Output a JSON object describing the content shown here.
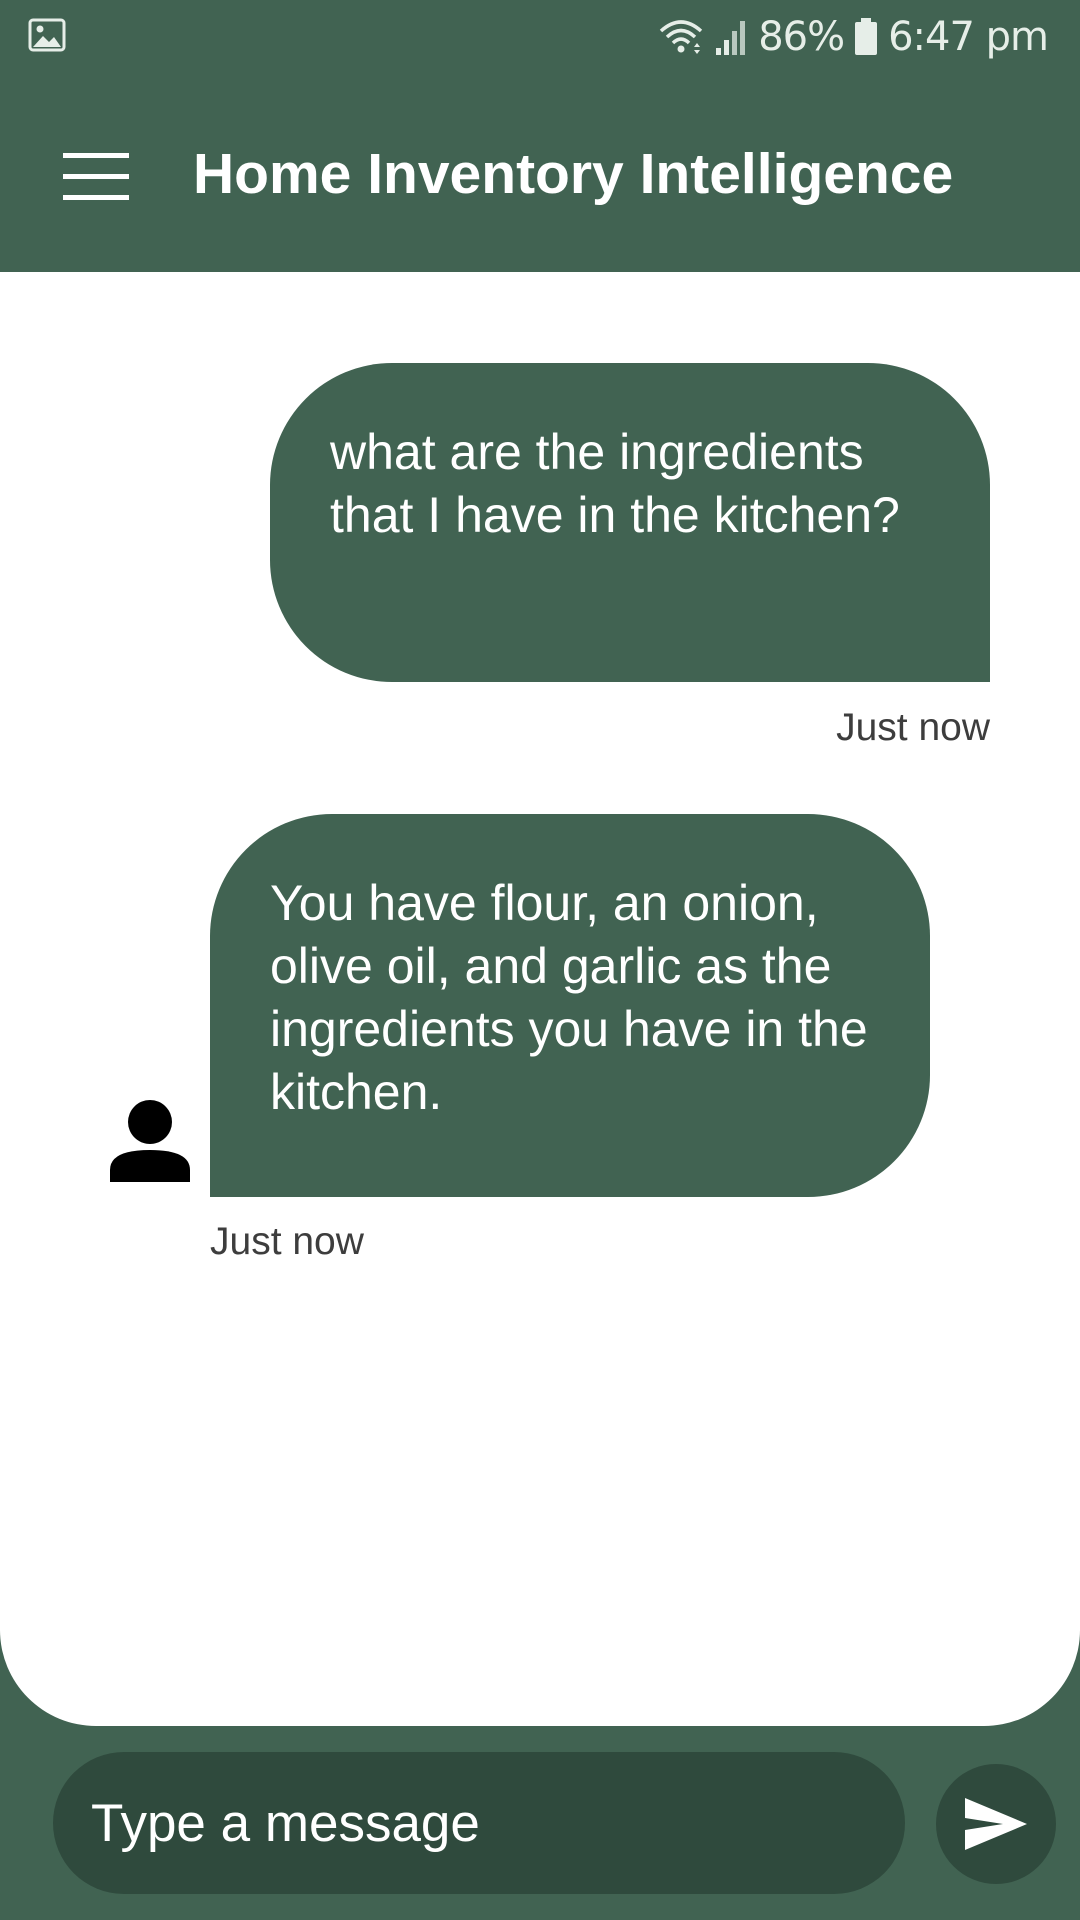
{
  "status_bar": {
    "battery": "86%",
    "time": "6:47 pm",
    "icons": [
      "gallery-icon",
      "wifi-icon",
      "signal-icon",
      "battery-icon"
    ]
  },
  "app_bar": {
    "title": "Home Inventory Intelligence",
    "menu_icon": "menu-icon"
  },
  "messages": [
    {
      "sender": "user",
      "text": "what are the ingredients that I have in the kitchen?",
      "timestamp": "Just now"
    },
    {
      "sender": "assistant",
      "text": "You have flour, an onion, olive oil, and garlic as the ingredients you have in the kitchen.",
      "timestamp": "Just now",
      "avatar_icon": "person-icon"
    }
  ],
  "composer": {
    "placeholder": "Type a message",
    "send_icon": "send-icon"
  },
  "colors": {
    "primary": "#416352",
    "composer_bg": "#2f4a3d",
    "chat_bg": "#ffffff",
    "bubble_text": "#ffffff",
    "timestamp_text": "#3d3d3d"
  }
}
